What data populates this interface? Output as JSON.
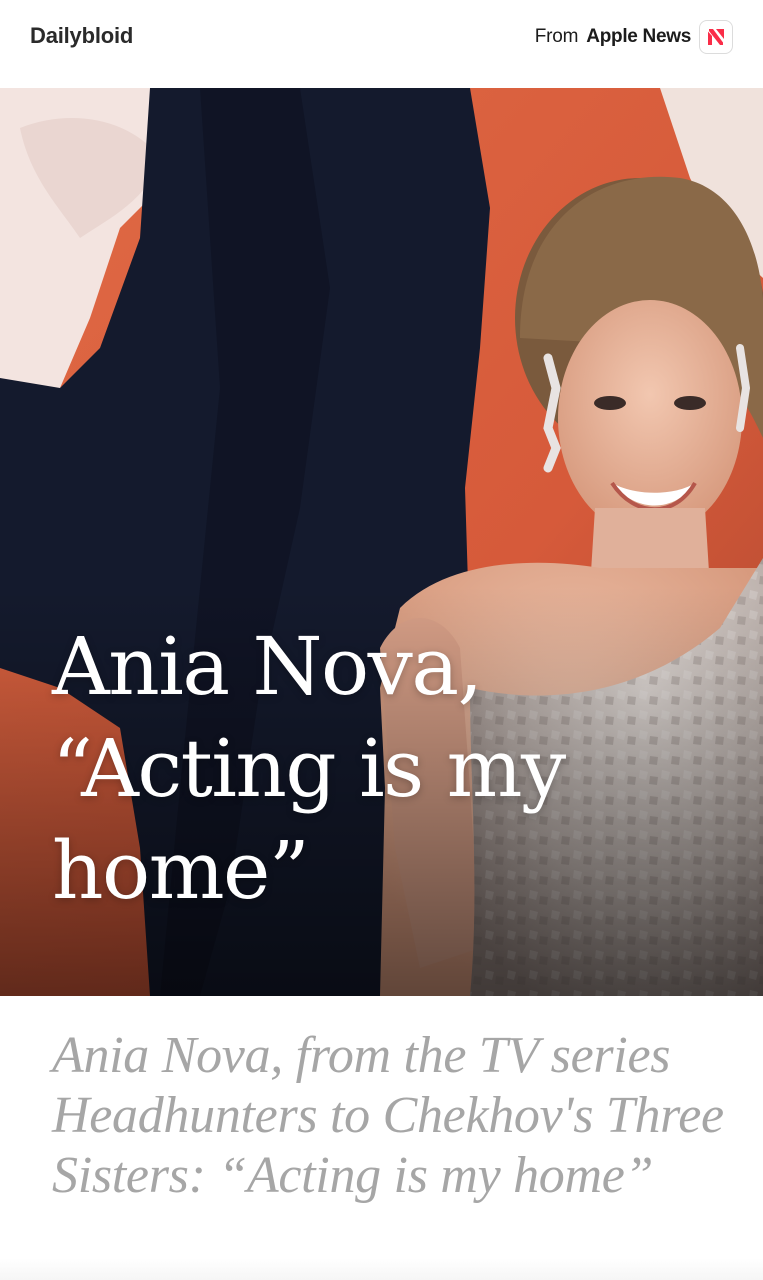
{
  "header": {
    "brand": "Dailybloid",
    "source_prefix": "From",
    "source_name": "Apple News",
    "source_icon": "apple-news-icon"
  },
  "hero": {
    "title": "Ania Nova, “Acting is my home”"
  },
  "article": {
    "subtitle": "Ania Nova, from the TV series Headhunters to Chekhov's Three Sisters: “Acting is my home”"
  },
  "colors": {
    "news_icon_red": "#fa2d48",
    "subtitle_gray": "#a6a6a6",
    "backdrop_orange": "#d85c3c"
  }
}
